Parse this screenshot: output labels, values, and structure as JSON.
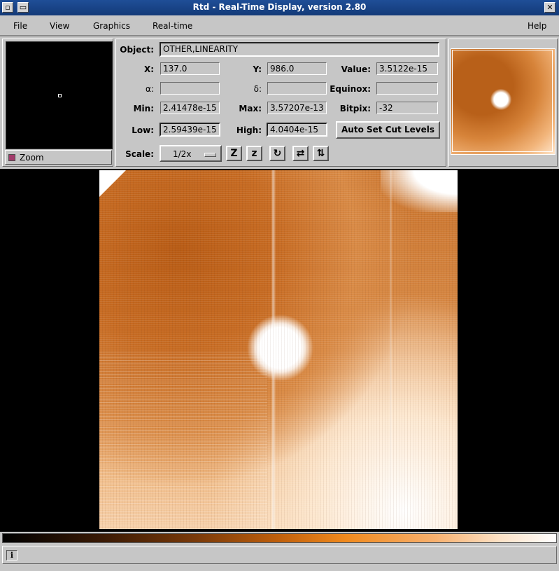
{
  "window": {
    "title": "Rtd - Real-Time Display, version 2.80"
  },
  "menubar": {
    "file": "File",
    "view": "View",
    "graphics": "Graphics",
    "realtime": "Real-time",
    "help": "Help"
  },
  "zoom": {
    "label": "Zoom"
  },
  "info": {
    "object_label": "Object:",
    "object_value": "OTHER,LINEARITY",
    "x_label": "X:",
    "x_value": "137.0",
    "y_label": "Y:",
    "y_value": "986.0",
    "value_label": "Value:",
    "value_value": "3.5122e-15",
    "alpha_label": "α:",
    "alpha_value": "",
    "delta_label": "δ:",
    "delta_value": "",
    "equinox_label": "Equinox:",
    "equinox_value": "",
    "min_label": "Min:",
    "min_value": "2.41478e-15",
    "max_label": "Max:",
    "max_value": "3.57207e-13",
    "bitpix_label": "Bitpix:",
    "bitpix_value": "-32",
    "low_label": "Low:",
    "low_value": "2.59439e-15",
    "high_label": "High:",
    "high_value": "4.0404e-15",
    "auto_cut_label": "Auto Set Cut Levels",
    "scale_label": "Scale:",
    "scale_value": "1/2x"
  },
  "toolbar": {
    "zoom_in_glyph": "Z",
    "zoom_out_glyph": "z",
    "rotate_glyph": "↻",
    "flip_x_glyph": "⇄",
    "flip_y_glyph": "⇅"
  },
  "status": {
    "info_glyph": "i"
  }
}
